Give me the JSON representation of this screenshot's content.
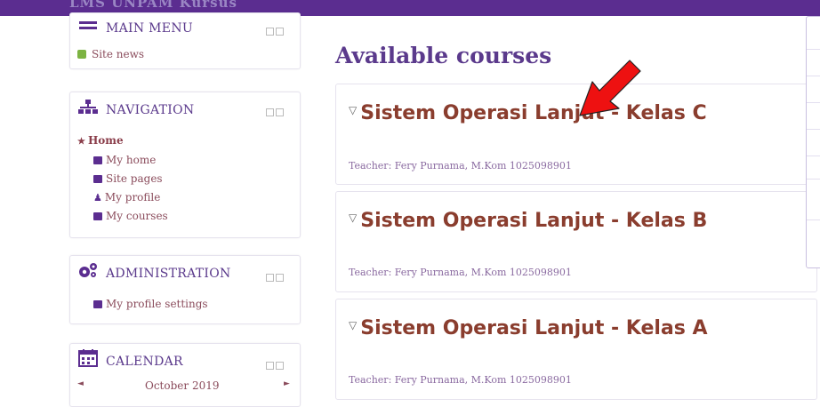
{
  "topbar": {
    "ghost_text": "LMS UNPAM   Kursus"
  },
  "blocks": {
    "main_menu": {
      "title": "MAIN MENU",
      "items": [
        {
          "label": "Site news"
        }
      ]
    },
    "navigation": {
      "title": "NAVIGATION",
      "home": "Home",
      "items": [
        {
          "label": "My home"
        },
        {
          "label": "Site pages"
        },
        {
          "label": "My profile"
        },
        {
          "label": "My courses"
        }
      ]
    },
    "administration": {
      "title": "ADMINISTRATION",
      "items": [
        {
          "label": "My profile settings"
        }
      ]
    },
    "calendar": {
      "title": "CALENDAR",
      "month": "October 2019",
      "prev": "◄",
      "next": "►"
    }
  },
  "main": {
    "title": "Available courses",
    "courses": [
      {
        "name": "Sistem Operasi Lanjut - Kelas C",
        "teacher": "Teacher: Fery Purnama, M.Kom 1025098901"
      },
      {
        "name": "Sistem Operasi Lanjut - Kelas B",
        "teacher": "Teacher: Fery Purnama, M.Kom 1025098901"
      },
      {
        "name": "Sistem Operasi Lanjut - Kelas A",
        "teacher": "Teacher: Fery Purnama, M.Kom 1025098901"
      }
    ]
  },
  "colors": {
    "brand": "#5b2d90",
    "course_title": "#8a3d2e",
    "annotation_arrow": "#ee1111"
  },
  "icons": [
    "hamburger-icon",
    "leaf-icon",
    "sitemap-icon",
    "home-icon",
    "folder-icon",
    "user-icon",
    "gears-icon",
    "calendar-icon",
    "lightbulb-icon",
    "red-arrow-annotation"
  ]
}
